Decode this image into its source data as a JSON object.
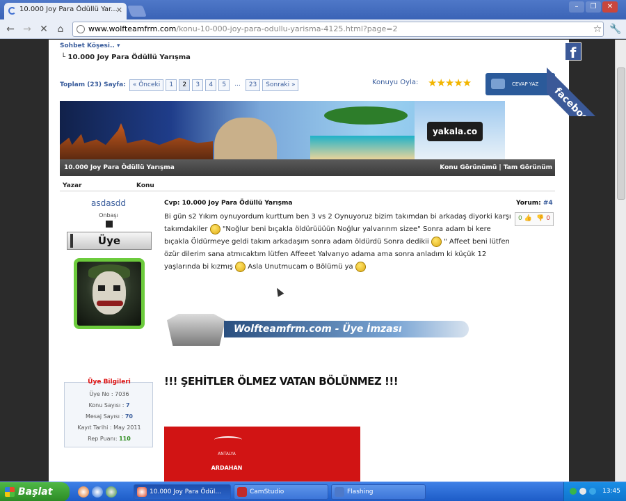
{
  "browser": {
    "tab_title": "10.000 Joy Para Ödüllü Yar...",
    "url_host": "www.wolfteamfrm.com",
    "url_path": "/konu-10-000-joy-para-odullu-yarisma-4125.html?page=2"
  },
  "page": {
    "breadcrumb_parent": "Sohbet Köşesi..",
    "breadcrumb_current": "10.000 Joy Para Ödüllü Yarışma",
    "pager": {
      "label": "Toplam (23) Sayfa:",
      "prev": "« Önceki",
      "pages": [
        "1",
        "2",
        "3",
        "4",
        "5"
      ],
      "current": "2",
      "dots": "...",
      "last": "23",
      "next": "Sonraki »"
    },
    "rating": {
      "label": "Konuyu Oyla:",
      "stars": "★★★★★"
    },
    "reply_button": "CEVAP YAZ",
    "banner_brand": "yakala.co",
    "facebook_label": "facebook",
    "thread_bar": {
      "title": "10.000 Joy Para Ödüllü Yarışma",
      "views": "Konu Görünümü | Tam Görünüm"
    },
    "columns": {
      "author": "Yazar",
      "topic": "Konu"
    },
    "user": {
      "name": "asdasdd",
      "rank_label": "Onbaşı",
      "badge": "Üye",
      "info_header": "Üye Bilgileri",
      "info": [
        {
          "label": "Üye No : ",
          "value": "7036",
          "color": ""
        },
        {
          "label": "Konu Sayısı : ",
          "value": "7",
          "color": "blue"
        },
        {
          "label": "Mesaj Sayısı : ",
          "value": "70",
          "color": "blue"
        },
        {
          "label": "Kayıt Tarihi : ",
          "value": "May 2011",
          "color": ""
        },
        {
          "label": "Rep Puanı: ",
          "value": "110",
          "color": "green"
        }
      ]
    },
    "post": {
      "title": "Cvp: 10.000 Joy Para Ödüllü Yarışma",
      "number_label": "Yorum: ",
      "number": "#4",
      "thumbs_up": "0",
      "thumbs_down": "0",
      "text_1": "Bi gün s2 Yıkım oynuyordum kurttum ben 3 vs 2 Oynuyoruz bizim takımdan bi arkadaş diyorki karşı takımdakiler ",
      "text_2": "\"Noğlur beni bıçakla öldürüüüün Noğlur yalvarırım sizee\" Sonra adam bi kere bıçakla Öldürmeye geldi takım arkadaşım sonra adam öldürdü Sonra dedikii ",
      "text_3": " \" Affeet beni lütfen özür dilerim sana atmıcaktım lütfen Affeeet Yalvarıyo adama ama sonra anladım ki küçük 12 yaşlarında bi kızmış ",
      "text_4": " Asla Unutmucam o Bölümü ya ",
      "signature": "Wolfteamfrm.com - Üye İmzası",
      "slogan": "!!! ŞEHİTLER ÖLMEZ VATAN BÖLÜNMEZ !!!",
      "image_line1": "ANTALYA",
      "image_line2": "ARDAHAN"
    }
  },
  "taskbar": {
    "start": "Başlat",
    "items": [
      "10.000 Joy Para Ödül...",
      "CamStudio",
      "Flashing"
    ],
    "clock": "13:45"
  },
  "colors": {
    "accent": "#3a5d9c",
    "facebook": "#3b5998",
    "stars": "#f2b500"
  }
}
